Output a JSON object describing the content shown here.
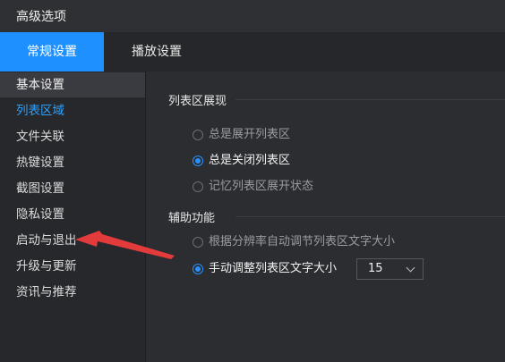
{
  "window": {
    "title": "高级选项"
  },
  "tabs": [
    {
      "label": "常规设置",
      "active": true
    },
    {
      "label": "播放设置",
      "active": false
    }
  ],
  "sidebar": {
    "items": [
      {
        "label": "基本设置"
      },
      {
        "label": "列表区域"
      },
      {
        "label": "文件关联"
      },
      {
        "label": "热键设置"
      },
      {
        "label": "截图设置"
      },
      {
        "label": "隐私设置"
      },
      {
        "label": "启动与退出"
      },
      {
        "label": "升级与更新"
      },
      {
        "label": "资讯与推荐"
      }
    ]
  },
  "list_section": {
    "title": "列表区展现",
    "options": [
      {
        "label": "总是展开列表区",
        "checked": false
      },
      {
        "label": "总是关闭列表区",
        "checked": true
      },
      {
        "label": "记忆列表区展开状态",
        "checked": false
      }
    ]
  },
  "aux_section": {
    "title": "辅助功能",
    "options": [
      {
        "label": "根据分辨率自动调节列表区文字大小",
        "checked": false
      },
      {
        "label": "手动调整列表区文字大小",
        "checked": true
      }
    ],
    "font_size_value": "15"
  },
  "colors": {
    "accent": "#1e90ff",
    "annotation": "#e33b3b"
  }
}
